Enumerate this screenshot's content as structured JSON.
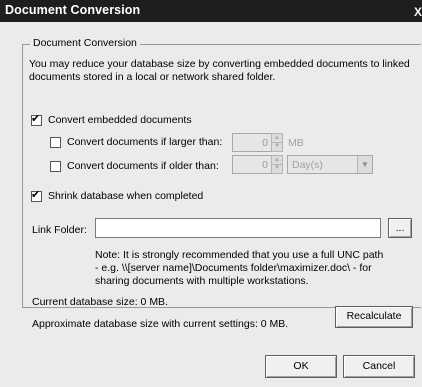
{
  "window": {
    "title": "Document Conversion",
    "close_glyph": "X"
  },
  "group": {
    "legend": "Document Conversion",
    "description_line1": "You may reduce your database size by converting embedded documents to linked",
    "description_line2": "documents stored in a local or network shared folder."
  },
  "convert_embedded": {
    "label": "Convert embedded documents",
    "checked": true
  },
  "larger_than": {
    "label": "Convert documents if larger than:",
    "checked": false,
    "value": "0",
    "unit": "MB"
  },
  "older_than": {
    "label": "Convert documents if older than:",
    "checked": false,
    "value": "0",
    "unit_selected": "Day(s)"
  },
  "shrink": {
    "label": "Shrink database when completed",
    "checked": true
  },
  "link_folder": {
    "label": "Link Folder:",
    "value": "",
    "browse_label": "..."
  },
  "note": {
    "line1": "Note: It is strongly recommended that you use a full UNC path",
    "line2": "- e.g. \\\\[server name]\\Documents folder\\maximizer.doc\\ - for",
    "line3": "sharing documents with multiple workstations."
  },
  "status": {
    "current_size": "Current database size:  0 MB.",
    "approx_size": "Approximate database size with current settings:  0 MB."
  },
  "buttons": {
    "recalculate": "Recalculate",
    "ok": "OK",
    "cancel": "Cancel"
  },
  "check_glyph": "✔",
  "spin_up_glyph": "▲",
  "spin_down_glyph": "▼",
  "combo_arrow_glyph": "▼",
  "colors": {
    "titlebar": "#1e1e1e",
    "dialog_bg": "#ebebeb"
  }
}
